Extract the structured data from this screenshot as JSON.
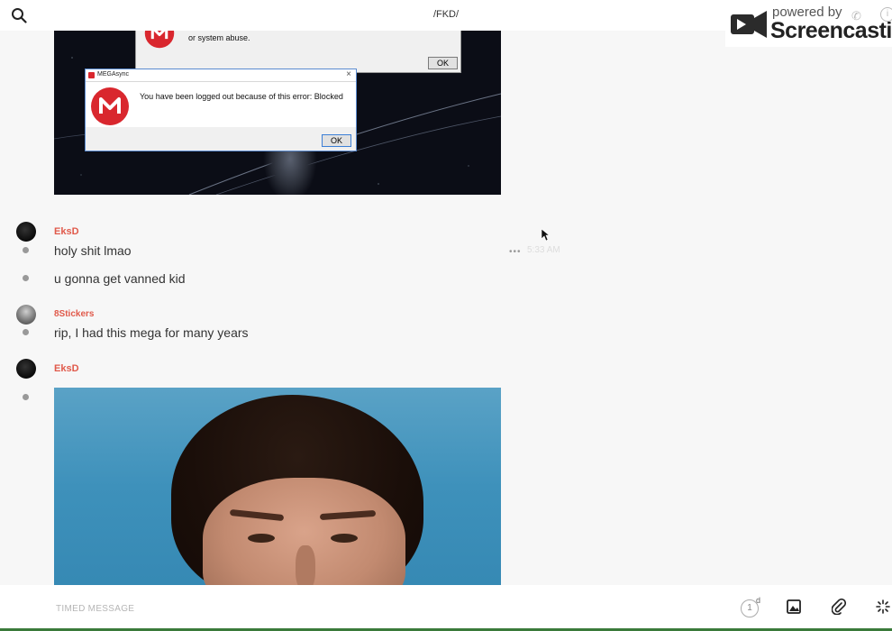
{
  "header": {
    "channel_title": "/FKD/"
  },
  "watermark": {
    "powered_by": "powered by",
    "brand": "Screencastify"
  },
  "screenshot_dialogs": {
    "back_dialog_text": "or system abuse.",
    "back_ok_label": "OK",
    "front_title": "MEGAsync",
    "front_close": "×",
    "front_message": "You have been logged out because of this error: Blocked",
    "front_ok_label": "OK"
  },
  "messages": [
    {
      "username": "EksD",
      "avatar": "dark-avatar",
      "lines": [
        "holy shit lmao",
        "u gonna get vanned kid"
      ],
      "timestamp": "5:33 AM"
    },
    {
      "username": "8Stickers",
      "avatar": "grey-avatar",
      "lines": [
        "rip, I had this mega for many years"
      ]
    },
    {
      "username": "EksD",
      "avatar": "dark-avatar",
      "attachment": "photo"
    }
  ],
  "composer": {
    "placeholder": "TIMED MESSAGE",
    "timer_value": "1",
    "timer_unit": "d"
  },
  "icons": {
    "search": "search-icon",
    "more": "more-options-icon",
    "cursor": "mouse-cursor-icon",
    "timer": "timer-icon",
    "image": "image-icon",
    "attach": "paperclip-icon",
    "giphy": "sparkle-icon"
  },
  "colors": {
    "username": "#e05a4b",
    "mega_red": "#d9272e",
    "background": "#f7f7f7"
  }
}
